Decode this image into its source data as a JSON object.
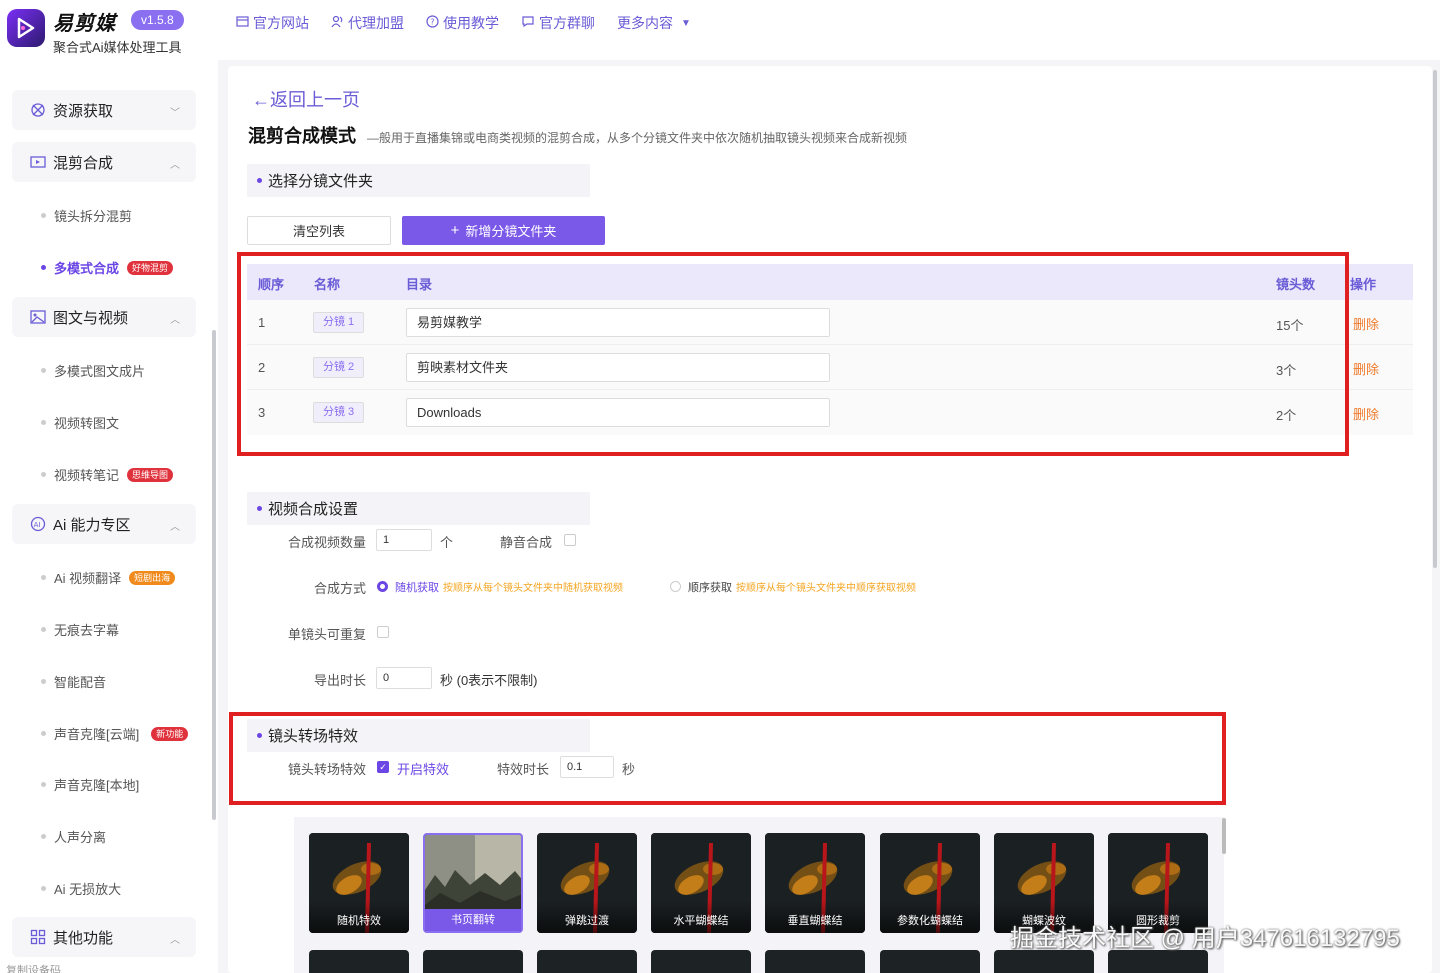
{
  "app": {
    "brand": "易剪媒",
    "version": "v1.5.8",
    "subtitle": "聚合式Ai媒体处理工具"
  },
  "topnav": [
    {
      "label": "官方网站",
      "icon": "window-icon"
    },
    {
      "label": "代理加盟",
      "icon": "user-group-icon"
    },
    {
      "label": "使用教学",
      "icon": "help-circle-icon"
    },
    {
      "label": "官方群聊",
      "icon": "chat-icon"
    },
    {
      "label": "更多内容",
      "icon": "caret-down-icon"
    }
  ],
  "sidebar": {
    "groups": [
      {
        "label": "资源获取",
        "icon": "resource-icon",
        "expanded": false
      },
      {
        "label": "混剪合成",
        "icon": "video-icon",
        "expanded": true
      },
      {
        "label": "图文与视频",
        "icon": "image-icon",
        "expanded": true
      },
      {
        "label": "Ai 能力专区",
        "icon": "ai-icon",
        "expanded": true
      },
      {
        "label": "其他功能",
        "icon": "grid-icon",
        "expanded": true
      }
    ],
    "items": [
      {
        "label": "镜头拆分混剪",
        "badge": ""
      },
      {
        "label": "多模式合成",
        "badge": "好物混剪",
        "active": true
      },
      {
        "label": "多模式图文成片",
        "badge": ""
      },
      {
        "label": "视频转图文",
        "badge": ""
      },
      {
        "label": "视频转笔记",
        "badge": "思维导图"
      },
      {
        "label": "Ai 视频翻译",
        "badge": "短剧出海"
      },
      {
        "label": "无痕去字幕",
        "badge": ""
      },
      {
        "label": "智能配音",
        "badge": ""
      },
      {
        "label": "声音克隆[云端]",
        "badge": "新功能"
      },
      {
        "label": "声音克隆[本地]",
        "badge": ""
      },
      {
        "label": "人声分离",
        "badge": ""
      },
      {
        "label": "Ai 无损放大",
        "badge": ""
      }
    ],
    "bottom_cut": "复制设备码"
  },
  "page": {
    "back": "返回上一页",
    "title": "混剪合成模式",
    "desc": "—般用于直播集锦或电商类视频的混剪合成，从多个分镜文件夹中依次随机抽取镜头视频来合成新视频"
  },
  "folder_section": {
    "title": "选择分镜文件夹",
    "clear_button": "清空列表",
    "add_button": "新增分镜文件夹",
    "columns": {
      "order": "顺序",
      "name": "名称",
      "dir": "目录",
      "count": "镜头数",
      "op": "操作"
    },
    "rows": [
      {
        "order": "1",
        "name": "分镜 1",
        "dir": "易剪媒教学",
        "count": "15个",
        "op": "删除"
      },
      {
        "order": "2",
        "name": "分镜 2",
        "dir": "剪映素材文件夹",
        "count": "3个",
        "op": "删除"
      },
      {
        "order": "3",
        "name": "分镜 3",
        "dir": "Downloads",
        "count": "2个",
        "op": "删除"
      }
    ]
  },
  "synth": {
    "title": "视频合成设置",
    "count_label": "合成视频数量",
    "count_value": "1",
    "count_unit": "个",
    "mute_label": "静音合成",
    "mode_label": "合成方式",
    "mode_random": "随机获取",
    "mode_random_hint": "按顺序从每个镜头文件夹中随机获取视频",
    "mode_seq": "顺序获取",
    "mode_seq_hint": "按顺序从每个镜头文件夹中顺序获取视频",
    "repeat_label": "单镜头可重复",
    "duration_label": "导出时长",
    "duration_value": "0",
    "duration_unit": "秒 (0表示不限制)"
  },
  "transition": {
    "title": "镜头转场特效",
    "label": "镜头转场特效",
    "enable": "开启特效",
    "dur_label": "特效时长",
    "dur_value": "0.1",
    "dur_unit": "秒",
    "effects": [
      "随机特效",
      "书页翻转",
      "弹跳过渡",
      "水平蝴蝶结",
      "垂直蝴蝶结",
      "参数化蝴蝶结",
      "蝴蝶波纹",
      "圆形裁剪"
    ]
  },
  "colors": {
    "accent": "#7a58e8",
    "danger": "#f07a2a",
    "highlight": "#e02020",
    "hint": "#f5a623"
  },
  "watermark": "掘金技术社区 @ 用户347616132795"
}
